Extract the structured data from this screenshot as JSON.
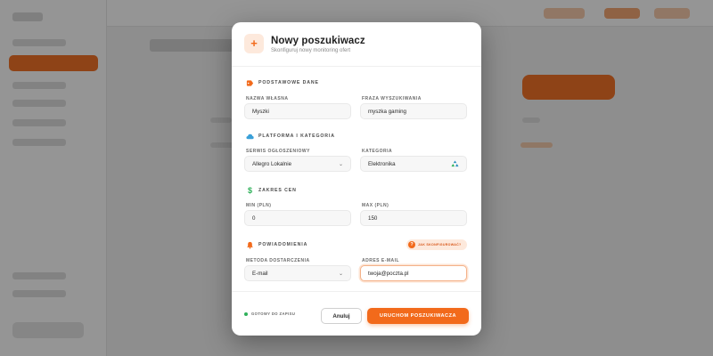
{
  "colors": {
    "accent": "#f26a1b",
    "accent_soft": "#fde9dc",
    "status_ok": "#2fb15a",
    "platform_icon": "#3aa0d8",
    "price_icon": "#2fb15a"
  },
  "modal": {
    "title": "Nowy poszukiwacz",
    "subtitle": "Skonfiguruj nowy monitoring ofert",
    "header_icon": "plus-icon"
  },
  "sections": {
    "basic": {
      "title": "Podstawowe dane",
      "icon": "tag-icon",
      "name_label": "Nazwa własna",
      "name_value": "Myszki",
      "phrase_label": "Fraza wyszukiwania",
      "phrase_value": "myszka gaming"
    },
    "platform": {
      "title": "Platforma i kategoria",
      "icon": "cloud-icon",
      "service_label": "Serwis ogłoszeniowy",
      "service_value": "Allegro Lokalnie",
      "category_label": "Kategoria",
      "category_value": "Elektronika",
      "category_icon": "shapes-icon"
    },
    "price": {
      "title": "Zakres cen",
      "icon": "dollar-icon",
      "min_label": "Min (PLN)",
      "min_value": "0",
      "max_label": "Max (PLN)",
      "max_value": "150"
    },
    "notifications": {
      "title": "Powiadomienia",
      "icon": "bell-icon",
      "help_label": "Jak skonfigurować?",
      "method_label": "Metoda dostarczenia",
      "method_value": "E-mail",
      "email_label": "Adres e-mail",
      "email_value": "twoja@poczta.pl"
    }
  },
  "footer": {
    "status_text": "Gotowy do zapisu",
    "cancel_label": "Anuluj",
    "submit_label": "Uruchom poszukiwacza"
  }
}
